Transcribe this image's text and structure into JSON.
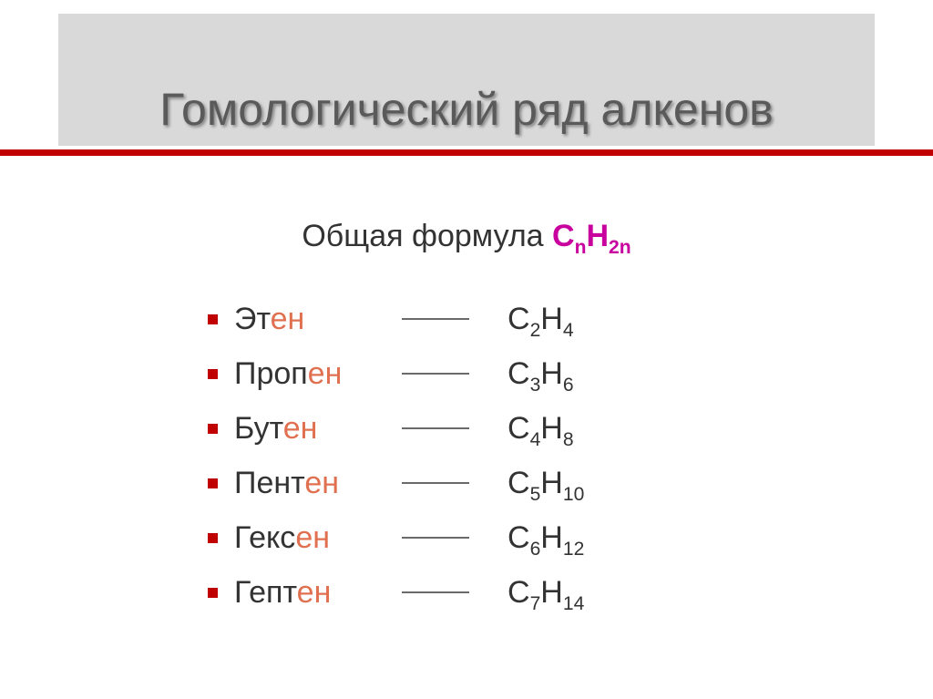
{
  "title": "Гомологический ряд алкенов",
  "subtitle_prefix": "Общая формула ",
  "general_formula": {
    "c": "C",
    "c_sub": "n",
    "h": "H",
    "h_sub": "2n"
  },
  "rows": [
    {
      "stem": "Эт",
      "suffix": "ен",
      "c_sub": "2",
      "h_sub": "4"
    },
    {
      "stem": "Проп",
      "suffix": "ен",
      "c_sub": "3",
      "h_sub": "6"
    },
    {
      "stem": "Бут",
      "suffix": "ен",
      "c_sub": "4",
      "h_sub": "8"
    },
    {
      "stem": "Пент",
      "suffix": "ен",
      "c_sub": "5",
      "h_sub": "10"
    },
    {
      "stem": "Гекс",
      "suffix": "ен",
      "c_sub": "6",
      "h_sub": "12"
    },
    {
      "stem": "Гепт",
      "suffix": "ен",
      "c_sub": "7",
      "h_sub": "14"
    }
  ],
  "symbols": {
    "C": "C",
    "H": "H"
  }
}
